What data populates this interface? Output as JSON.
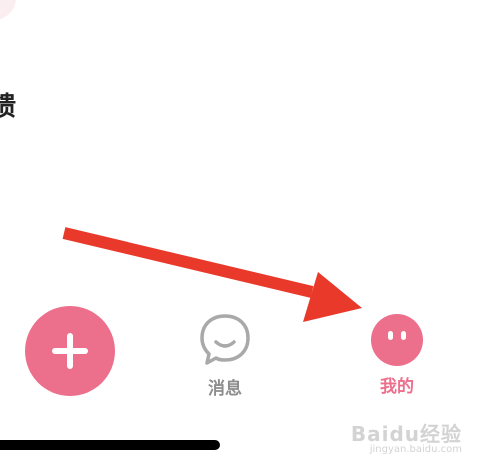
{
  "header": {
    "partial_title": "馈"
  },
  "tab_bar": {
    "add_button_icon": "plus-icon",
    "messages": {
      "label": "消息",
      "icon": "chat-bubble-icon"
    },
    "mine": {
      "label": "我的",
      "icon": "face-icon"
    }
  },
  "annotation": {
    "arrow_color": "#e8392a"
  },
  "watermark": {
    "logo_text": "Baidu经验",
    "url": "jingyan.baidu.com"
  },
  "colors": {
    "accent": "#ec6f8c",
    "inactive": "#8d8d8d"
  }
}
